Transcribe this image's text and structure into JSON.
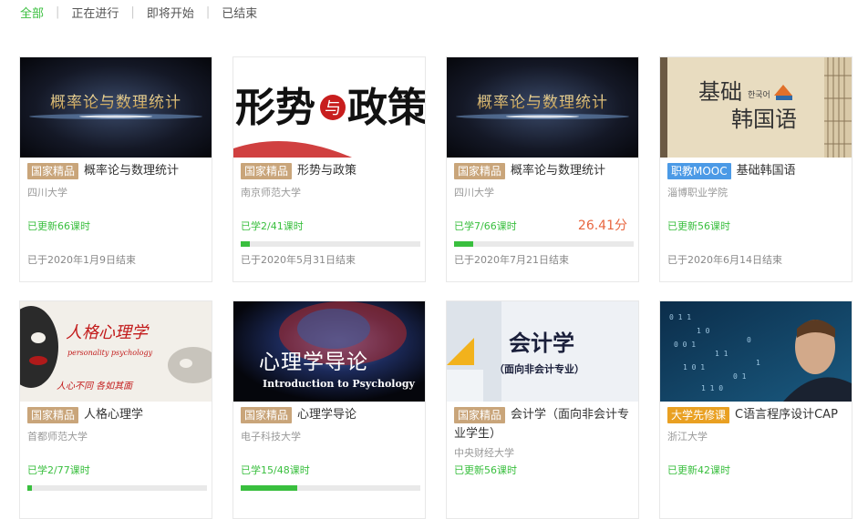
{
  "filters": {
    "all": "全部",
    "ongoing": "正在进行",
    "upcoming": "即将开始",
    "ended": "已结束"
  },
  "courses": [
    {
      "thumb_text": "概率论与数理统计",
      "badge": "国家精品",
      "title": "概率论与数理统计",
      "university": "四川大学",
      "progress": "已更新66课时",
      "end": "已于2020年1月9日结束"
    },
    {
      "thumb_text_1": "形势",
      "thumb_text_2": "与",
      "thumb_text_3": "政策",
      "badge": "国家精品",
      "title": "形势与政策",
      "university": "南京师范大学",
      "progress": "已学2/41课时",
      "progress_fraction": 0.049,
      "end": "已于2020年5月31日结束"
    },
    {
      "thumb_text": "概率论与数理统计",
      "badge": "国家精品",
      "title": "概率论与数理统计",
      "university": "四川大学",
      "progress": "已学7/66课时",
      "progress_fraction": 0.106,
      "score": "26.41分",
      "end": "已于2020年7月21日结束"
    },
    {
      "thumb_text_1": "基础",
      "thumb_text_2": "韩国语",
      "thumb_text_3": "한국어",
      "badge": "职教MOOC",
      "title": "基础韩国语",
      "university": "淄博职业学院",
      "progress": "已更新56课时",
      "end": "已于2020年6月14日结束"
    },
    {
      "thumb_text_1": "人格心理学",
      "thumb_text_2": "personality psychology",
      "thumb_text_3": "人心不同 各如其面",
      "badge": "国家精品",
      "title": "人格心理学",
      "university": "首都师范大学",
      "progress": "已学2/77课时",
      "progress_fraction": 0.026
    },
    {
      "thumb_text_1": "心理学导论",
      "thumb_text_2": "Introduction to Psychology",
      "badge": "国家精品",
      "title": "心理学导论",
      "university": "电子科技大学",
      "progress": "已学15/48课时",
      "progress_fraction": 0.3125
    },
    {
      "thumb_text_1": "会计学",
      "thumb_text_2": "（面向非会计专业）",
      "badge": "国家精品",
      "title": "会计学（面向非会计专业学生）",
      "university": "中央财经大学",
      "progress": "已更新56课时"
    },
    {
      "badge": "大学先修课",
      "title": "C语言程序设计CAP",
      "university": "浙江大学",
      "progress": "已更新42课时"
    }
  ],
  "colors": {
    "accent": "#39bf3e",
    "badge_national": "#c9a57a",
    "badge_vocational": "#4b9ae6",
    "badge_preparatory": "#e9a022",
    "score": "#e8663f"
  }
}
